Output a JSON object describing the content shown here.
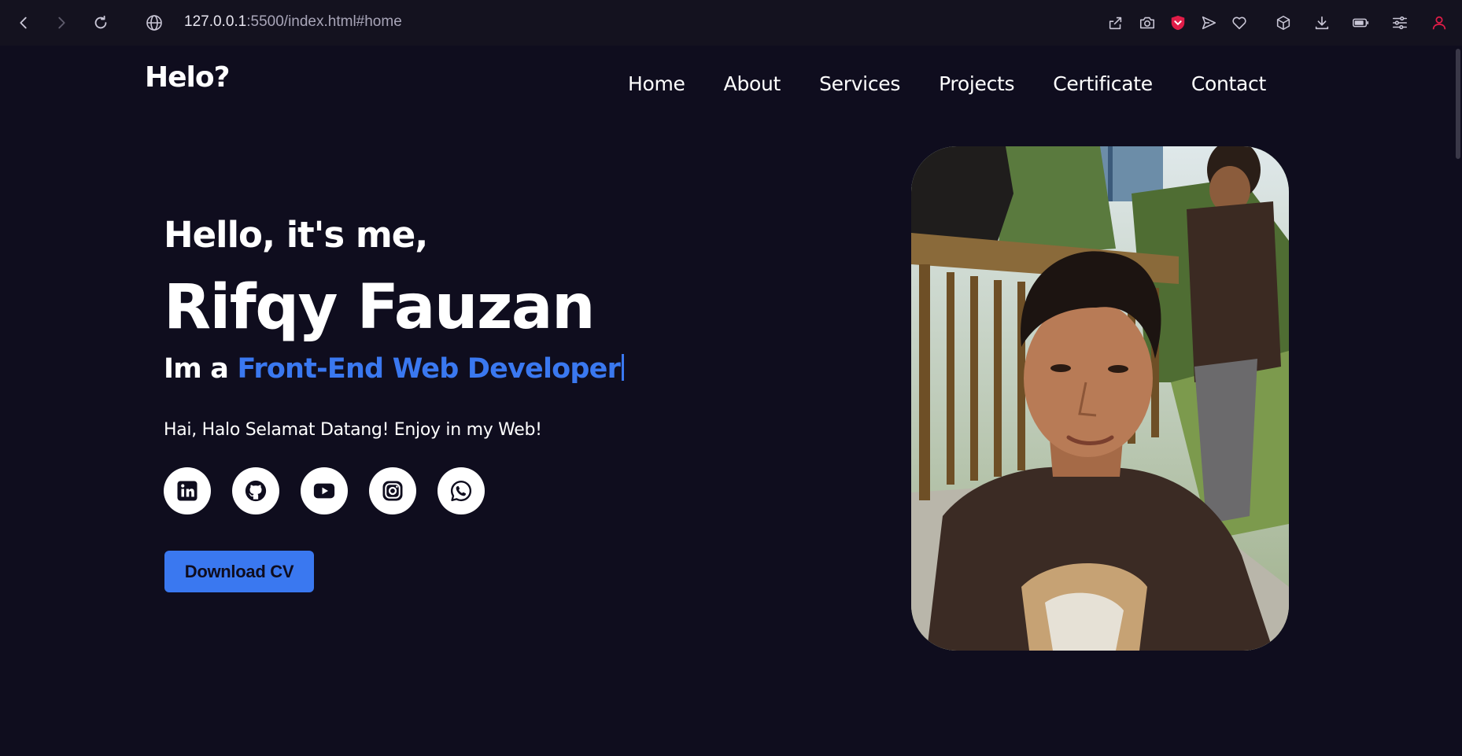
{
  "browser": {
    "url_host": "127.0.0.1",
    "url_rest": ":5500/index.html#home",
    "nav_icons": [
      "back-arrow-icon",
      "forward-arrow-icon",
      "reload-icon"
    ],
    "toolbar_icons": [
      "share-icon",
      "camera-icon",
      "shield-icon",
      "send-icon",
      "heart-icon",
      "cube-icon",
      "download-icon",
      "battery-icon",
      "sliders-icon",
      "profile-icon"
    ],
    "accent_color": "#e11d48"
  },
  "header": {
    "logo": "Helo?",
    "nav": [
      "Home",
      "About",
      "Services",
      "Projects",
      "Certificate",
      "Contact"
    ]
  },
  "hero": {
    "greeting": "Hello, it's me,",
    "name": "Rifqy Fauzan",
    "role_prefix": "Im a ",
    "role_highlight": "Front-End Web Developer",
    "intro": "Hai, Halo Selamat Datang! Enjoy in my Web!",
    "socials": [
      "linkedin-icon",
      "github-icon",
      "youtube-icon",
      "instagram-icon",
      "whatsapp-icon"
    ],
    "download_label": "Download CV",
    "accent_color": "#3a78f0"
  },
  "colors": {
    "background": "#0f0d1e",
    "chrome": "#14121f"
  }
}
